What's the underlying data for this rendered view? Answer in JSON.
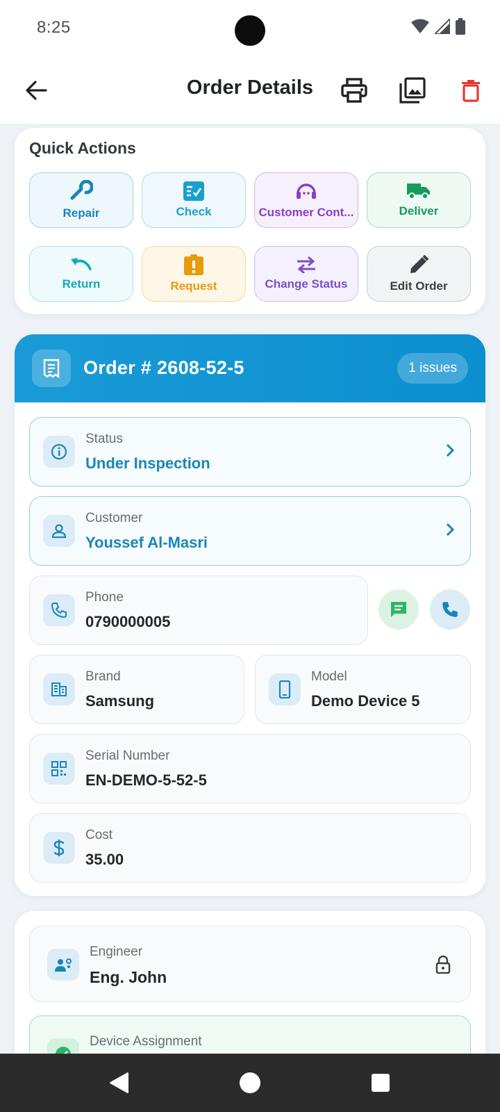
{
  "status_bar": {
    "time": "8:25"
  },
  "app_bar": {
    "title": "Order Details"
  },
  "quick_actions": {
    "title": "Quick Actions",
    "items": [
      {
        "label": "Repair",
        "icon": "wrench-icon",
        "color": "#1a86b8"
      },
      {
        "label": "Check",
        "icon": "checklist-icon",
        "color": "#1aa0d0"
      },
      {
        "label": "Customer Cont...",
        "icon": "support-agent-icon",
        "color": "#8a3fc2"
      },
      {
        "label": "Deliver",
        "icon": "truck-icon",
        "color": "#179a5e"
      },
      {
        "label": "Return",
        "icon": "undo-icon",
        "color": "#14a8b8"
      },
      {
        "label": "Request",
        "icon": "alert-clipboard-icon",
        "color": "#e79a0c"
      },
      {
        "label": "Change Status",
        "icon": "swap-arrows-icon",
        "color": "#7b4fc4"
      },
      {
        "label": "Edit Order",
        "icon": "pencil-icon",
        "color": "#3a3f45"
      }
    ]
  },
  "order": {
    "title": "Order #  2608-52-5",
    "badge": "1 issues",
    "status": {
      "label": "Status",
      "value": "Under Inspection"
    },
    "customer": {
      "label": "Customer",
      "value": "Youssef Al-Masri"
    },
    "phone": {
      "label": "Phone",
      "value": "0790000005"
    },
    "brand": {
      "label": "Brand",
      "value": "Samsung"
    },
    "model": {
      "label": "Model",
      "value": "Demo Device 5"
    },
    "serial": {
      "label": "Serial Number",
      "value": "EN-DEMO-5-52-5"
    },
    "cost": {
      "label": "Cost",
      "value": "35.00"
    }
  },
  "assignment": {
    "engineer": {
      "label": "Engineer",
      "value": "Eng. John"
    },
    "device_assignment": {
      "label": "Device Assignment"
    }
  },
  "colors": {
    "accent": "#1a9bd7",
    "danger": "#e5382f",
    "green": "#2fb56a"
  }
}
